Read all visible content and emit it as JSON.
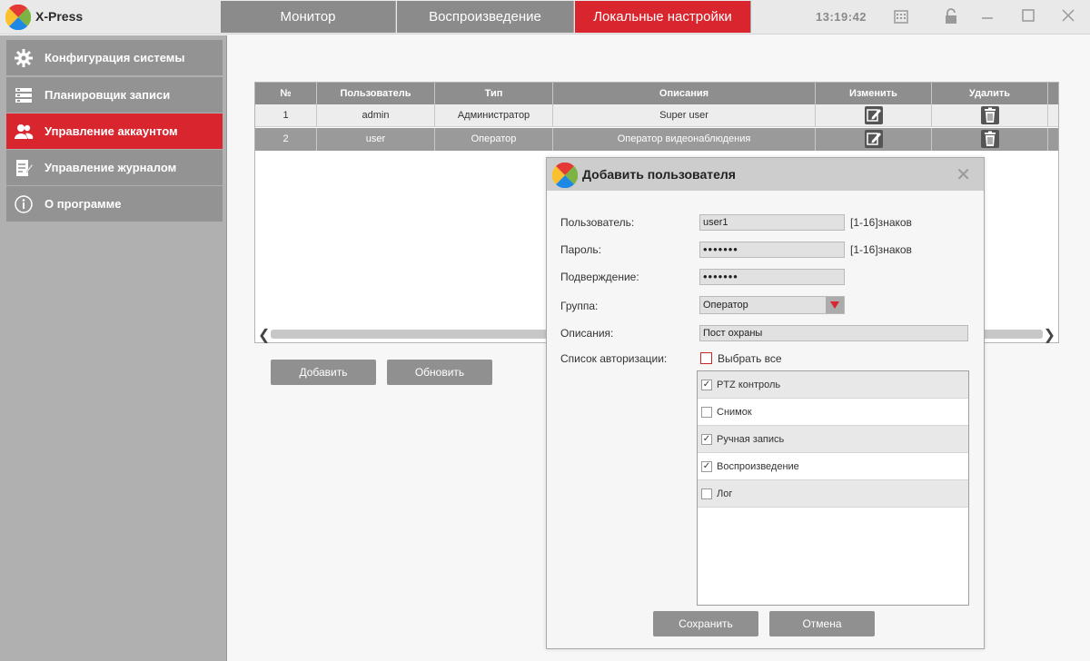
{
  "app": {
    "name": "X-Press",
    "time": "13:19:42"
  },
  "tabs": [
    {
      "label": "Монитор",
      "active": false
    },
    {
      "label": "Воспроизведение",
      "active": false
    },
    {
      "label": "Локальные настройки",
      "active": true
    }
  ],
  "window_icons": [
    "calendar-icon",
    "lock-icon",
    "minimize-icon",
    "maximize-icon",
    "close-icon"
  ],
  "sidebar": {
    "items": [
      {
        "label": "Конфигурация системы",
        "icon": "gear-icon",
        "active": false
      },
      {
        "label": "Планировщик записи",
        "icon": "storage-icon",
        "active": false
      },
      {
        "label": "Управление аккаунтом",
        "icon": "users-icon",
        "active": true
      },
      {
        "label": "Управление журналом",
        "icon": "journal-icon",
        "active": false
      },
      {
        "label": "О программе",
        "icon": "info-icon",
        "active": false
      }
    ]
  },
  "accounts_table": {
    "columns": [
      "№",
      "Пользователь",
      "Тип",
      "Описания",
      "Изменить",
      "Удалить"
    ],
    "rows": [
      {
        "num": "1",
        "user": "admin",
        "type": "Администратор",
        "desc": "Super user"
      },
      {
        "num": "2",
        "user": "user",
        "type": "Оператор",
        "desc": "Оператор видеонаблюдения"
      }
    ]
  },
  "buttons": {
    "add": "Добавить",
    "refresh": "Обновить"
  },
  "dialog": {
    "title": "Добавить пользователя",
    "user_label": "Пользователь:",
    "user_value": "user1",
    "user_hint": "[1-16]знаков",
    "password_label": "Пароль:",
    "password_value": "•••••••",
    "password_hint": "[1-16]знаков",
    "confirm_label": "Подверждение:",
    "confirm_value": "•••••••",
    "group_label": "Группа:",
    "group_value": "Оператор",
    "desc_label": "Описания:",
    "desc_value": "Пост охраны",
    "auth_label": "Список авторизации:",
    "select_all": "Выбрать все",
    "permissions": [
      {
        "label": "PTZ контроль",
        "checked": true
      },
      {
        "label": "Снимок",
        "checked": false
      },
      {
        "label": "Ручная запись",
        "checked": true
      },
      {
        "label": "Воспроизведение",
        "checked": true
      },
      {
        "label": "Лог",
        "checked": false
      }
    ],
    "save": "Сохранить",
    "cancel": "Отмена"
  },
  "colors": {
    "accent": "#d9262e",
    "sidebar_item": "#939393",
    "sidebar_bg": "#b0b0b0",
    "button": "#909090"
  }
}
